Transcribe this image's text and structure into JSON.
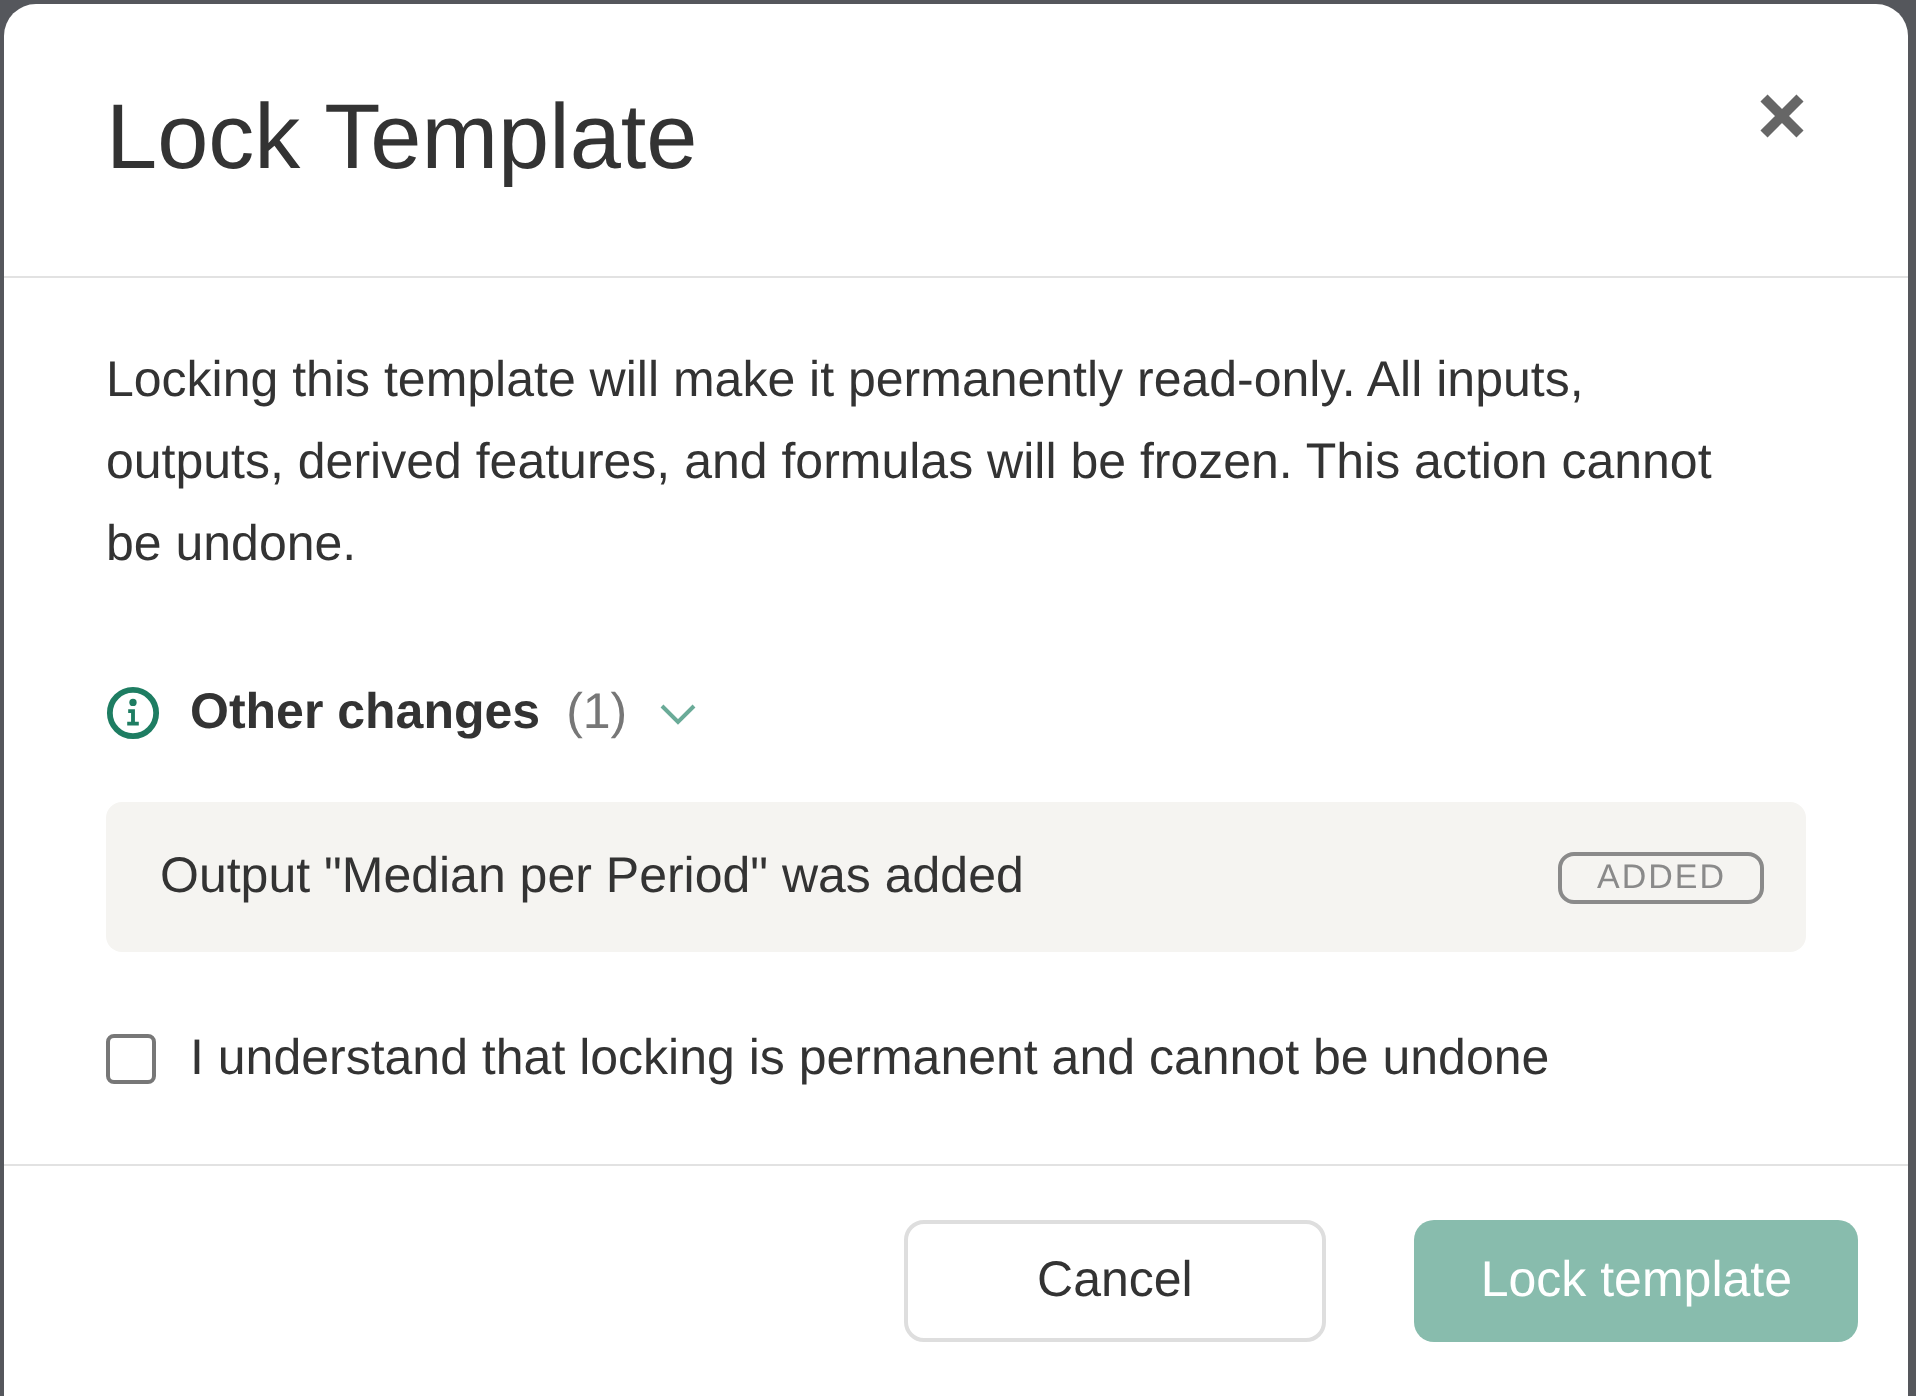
{
  "dialog": {
    "title": "Lock Template"
  },
  "message": "Locking this template will make it permanently read-only. All inputs, outputs, derived features, and formulas will be frozen. This action cannot be undone.",
  "changes": {
    "title": "Other changes",
    "count": "(1)",
    "expanded": true,
    "items": [
      {
        "text": "Output \"Median per Period\" was added",
        "tag": "ADDED"
      }
    ]
  },
  "confirm": {
    "label": "I understand that locking is permanent and cannot be undone",
    "checked": false
  },
  "buttons": [
    {
      "label": "Cancel",
      "kind": "secondary",
      "disabled": false
    },
    {
      "label": "Lock template",
      "kind": "primary",
      "disabled": true
    }
  ]
}
